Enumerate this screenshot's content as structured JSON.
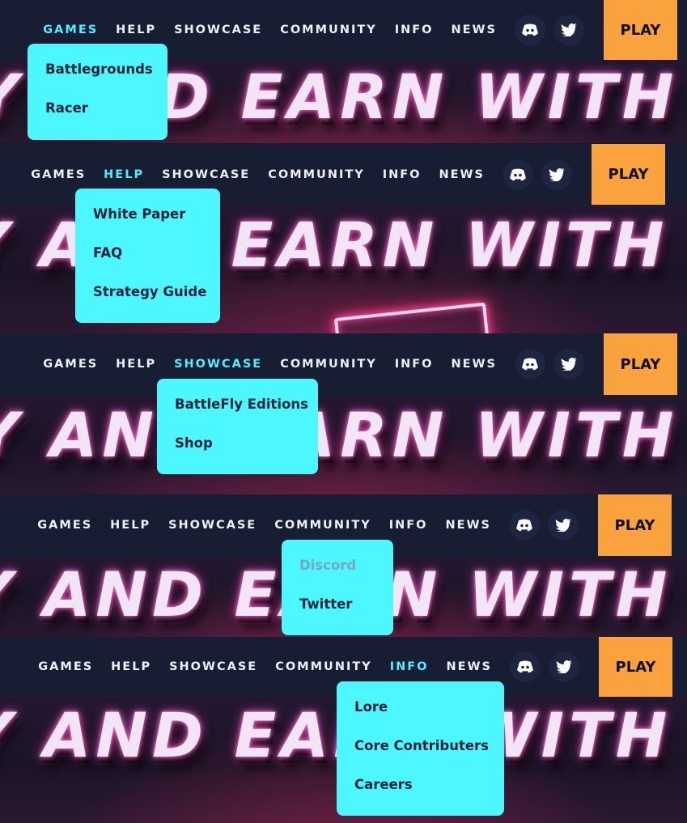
{
  "nav": {
    "items": [
      "GAMES",
      "HELP",
      "SHOWCASE",
      "COMMUNITY",
      "INFO",
      "NEWS"
    ],
    "play_label": "PLAY",
    "social": [
      "discord-icon",
      "twitter-icon"
    ]
  },
  "hero": {
    "panel1": "Y AND EARN WITH",
    "panel2": "Y AND EARN WITH",
    "panel3": "Y AND EARN WITH",
    "panel4": "Y AND EARN WITH",
    "panel5": "Y AND EARN WITH"
  },
  "dropdowns": {
    "games": [
      "Battlegrounds",
      "Racer"
    ],
    "help": [
      "White Paper",
      "FAQ",
      "Strategy Guide"
    ],
    "showcase": [
      "BattleFly Editions",
      "Shop"
    ],
    "community": [
      "Discord",
      "Twitter"
    ],
    "info": [
      "Lore",
      "Core Contributers",
      "Careers"
    ]
  },
  "colors": {
    "accent": "#4ef0ff",
    "dropdown_bg": "#4df7ff",
    "play_bg": "#f9a23e",
    "nav_bg": "#171d33"
  }
}
